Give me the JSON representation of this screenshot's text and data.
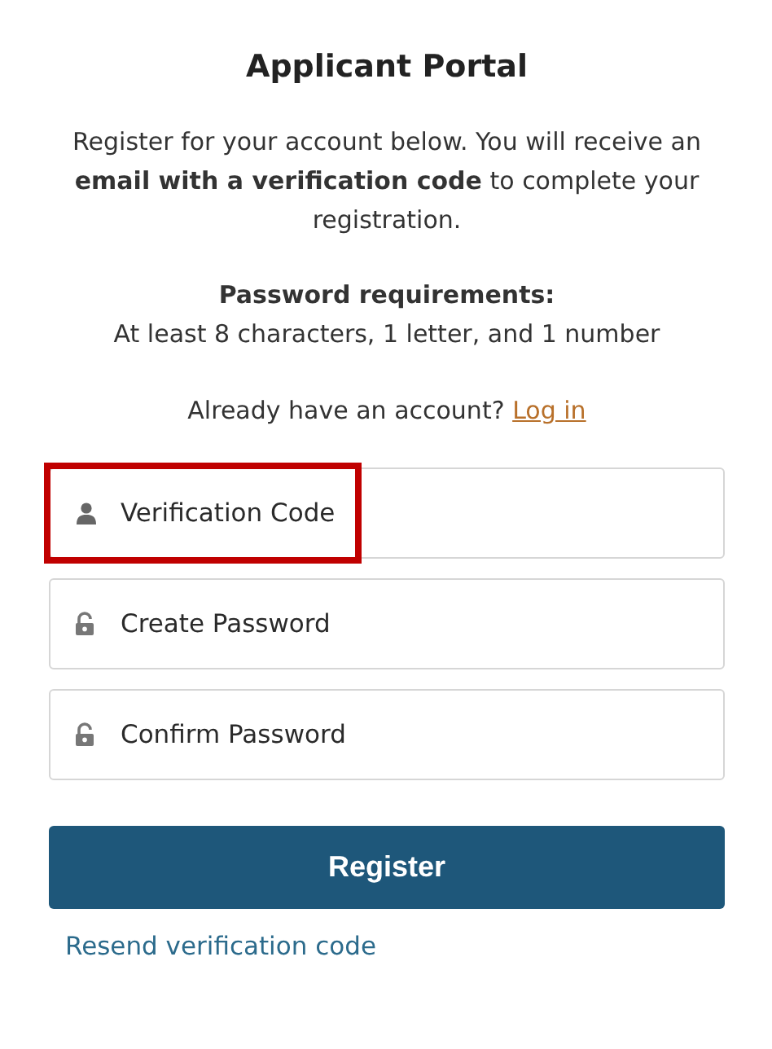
{
  "title": "Applicant Portal",
  "intro": "Register for your account below. You will receive an **email with a verification code** to complete your registration.",
  "requirements": {
    "heading": "Password requirements:",
    "text": "At least 8 characters, 1 letter, and 1 number"
  },
  "login_prompt": {
    "text": "Already have an account?",
    "link": "Log in"
  },
  "fields": [
    {
      "kind": "user",
      "placeholder": "Verification Code",
      "highlighted": true
    },
    {
      "kind": "lock",
      "placeholder": "Create Password",
      "highlighted": false
    },
    {
      "kind": "lock",
      "placeholder": "Confirm Password",
      "highlighted": false
    }
  ],
  "submit": "Register",
  "resend_link": "Resend verification code"
}
